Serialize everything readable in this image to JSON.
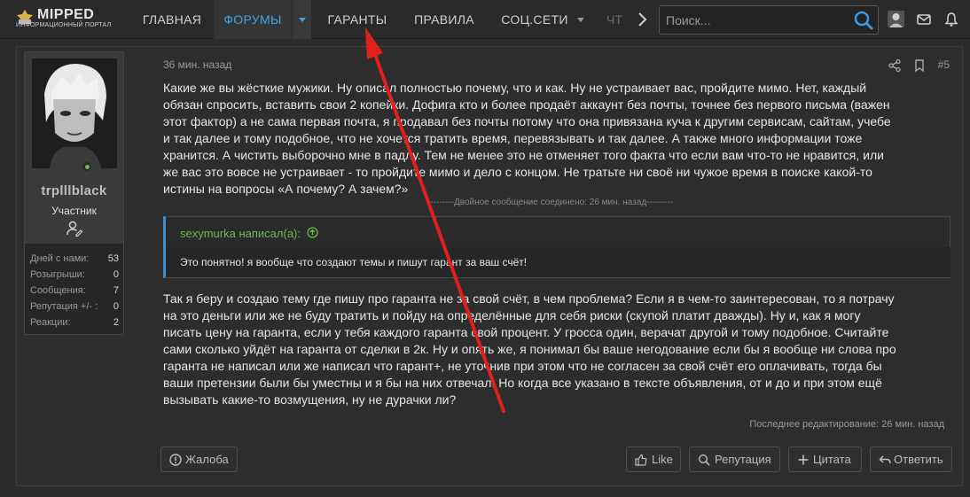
{
  "logo": {
    "name": "MIPPED",
    "sub": "ИНФОРМАЦИОННЫЙ ПОРТАЛ"
  },
  "nav": {
    "items": [
      "ГЛАВНАЯ",
      "ФОРУМЫ",
      "ГАРАНТЫ",
      "ПРАВИЛА",
      "СОЦ.СЕТИ",
      "ЧТ"
    ],
    "active": "ФОРУМЫ"
  },
  "search": {
    "placeholder": "Поиск..."
  },
  "colors": {
    "accent": "#4aa3df",
    "quote_border": "#3e8fd0",
    "online": "#6dbb4a",
    "annotation_arrow": "#e0201a"
  },
  "user": {
    "name": "trplllblack",
    "title": "Участник",
    "stats": [
      {
        "label": "Дней с нами:",
        "value": "53"
      },
      {
        "label": "Розыгрыши:",
        "value": "0"
      },
      {
        "label": "Сообщения:",
        "value": "7"
      },
      {
        "label": "Репутация +/- :",
        "value": "0"
      },
      {
        "label": "Реакции:",
        "value": "2"
      }
    ]
  },
  "post": {
    "time": "36 мин. назад",
    "number": "#5",
    "paragraph1": [
      "Какие же вы жёсткие мужики. Ну описал полностью почему, что и как. Ну не устраивает вас, пройдите мимо. Нет, каждый",
      "обязан спросить, вставить свои 2 копейки. Дофига кто и более продаёт аккаунт без почты, точнее без первого письма (важен",
      "этот фактор) а не сама первая почта, я продавал без почты потому что она привязана куча к другим сервисам, сайтам, учебе",
      "и так далее и тому подобное, что не хочется тратить время, перевязывать и так далее. А также много информации тоже",
      "хранится. А чистить выборочно мне в падлу. Тем не менее это не отменяет того факта что если вам что-то не нравится, или",
      "же вас это вовсе не устраивает - то пройдите мимо и дело с концом. Не тратьте ни своё ни чужое время в поиске какой-то",
      "истины на вопросы «А почему? А зачем?»"
    ],
    "merged_note": "---------Двойное сообщение соединено: 26 мин. назад---------",
    "quote": {
      "author": "sexymurka написал(а):",
      "text": "Это понятно! я вообще что создают темы и пишут гарант за ваш счёт!"
    },
    "paragraph2": [
      "Так я беру и создаю тему где пишу про гаранта не за свой счёт, в чем проблема? Если я в чем-то заинтересован, то я потрачу",
      "на это деньги или же не буду тратить и пойду на определённые для себя риски (скупой платит дважды). Ну и, как я могу",
      "писать цену на гаранта, если у тебя каждого гаранта свой процент. У гросса один, верачат другой и тому подобное. Считайте",
      "сами сколько уйдёт на гаранта от сделки в 2к. Ну и опять же, я понимал бы ваше негодование если бы я вообще ни слова про",
      "гаранта не написал или же написал что гарант+, не уточнив при этом что не согласен за свой счёт его оплачивать, тогда бы",
      "ваши претензии были бы уместны и я бы на них отвечал. Но когда все указано в тексте объявления, от и до и при этом ещё",
      "вызывать какие-то возмущения, ну не дурачки ли?"
    ],
    "edited": "Последнее редактирование: 26 мин. назад"
  },
  "actions": {
    "report": "Жалоба",
    "like": "Like",
    "reputation": "Репутация",
    "quote": "Цитата",
    "reply": "Ответить"
  }
}
